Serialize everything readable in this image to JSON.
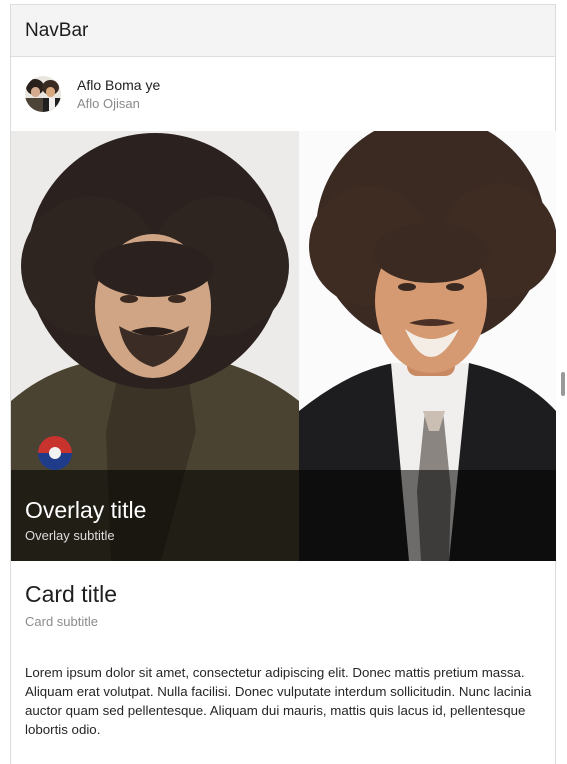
{
  "navbar": {
    "title": "NavBar"
  },
  "card": {
    "author": "Aflo Boma ye",
    "author_subtitle": "Aflo Ojisan",
    "overlay_title": "Overlay title",
    "overlay_subtitle": "Overlay subtitle",
    "title": "Card title",
    "subtitle": "Card subtitle",
    "text": "Lorem ipsum dolor sit amet, consectetur adipiscing elit. Donec mattis pretium massa. Aliquam erat volutpat. Nulla facilisi. Donec vulputate interdum sollicitudin. Nunc lacinia auctor quam sed pellentesque. Aliquam dui mauris, mattis quis lacus id, pellentesque lobortis odio."
  },
  "icons": {
    "avatar": "avatar-image",
    "photo": "card-media-image"
  }
}
